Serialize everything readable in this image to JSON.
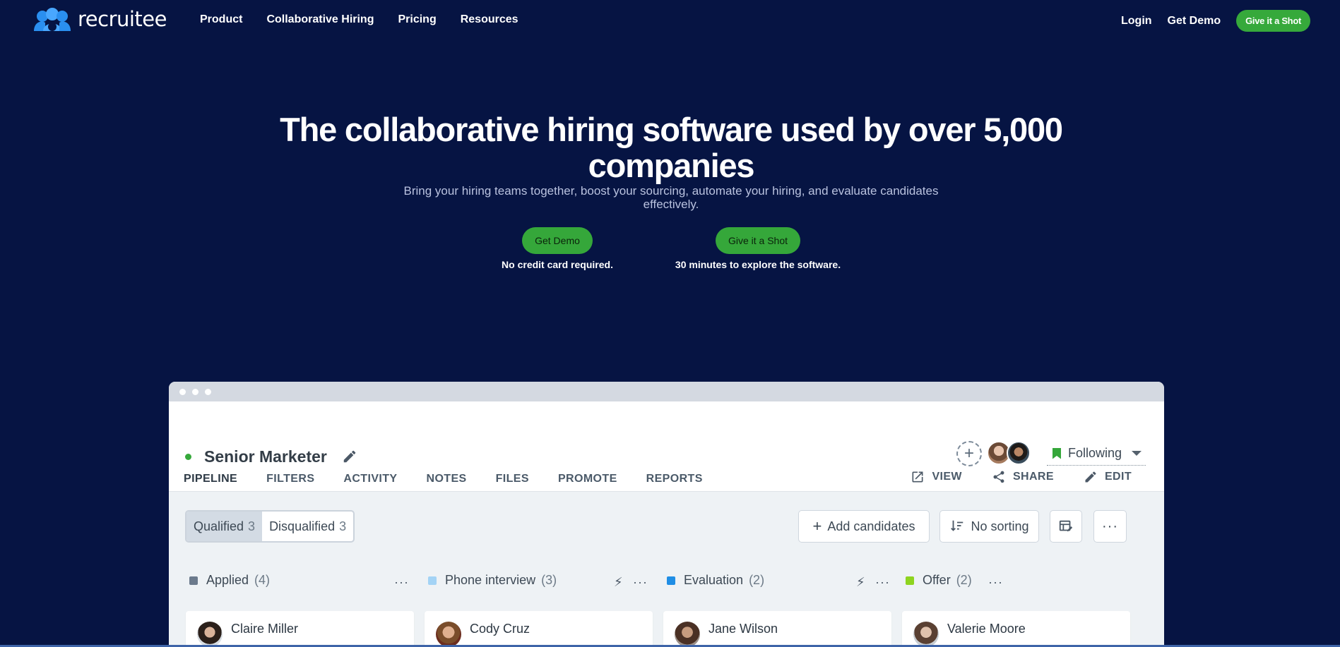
{
  "brand": {
    "name": "recruitee"
  },
  "nav": {
    "links": [
      "Product",
      "Collaborative Hiring",
      "Pricing",
      "Resources"
    ],
    "login": "Login",
    "get_demo": "Get Demo",
    "give_shot": "Give it a Shot"
  },
  "hero": {
    "title": "The collaborative hiring software used by over 5,000 companies",
    "subtitle": "Bring your hiring teams together, boost your sourcing, automate your hiring, and evaluate candidates effectively.",
    "cta_demo": {
      "label": "Get Demo",
      "note": "No credit card required."
    },
    "cta_shot": {
      "label": "Give it a Shot",
      "note": "30 minutes to explore the software."
    }
  },
  "app": {
    "job_title": "Senior Marketer",
    "following": "Following",
    "tabs": [
      "PIPELINE",
      "FILTERS",
      "ACTIVITY",
      "NOTES",
      "FILES",
      "PROMOTE",
      "REPORTS"
    ],
    "active_tab": "PIPELINE",
    "actions": {
      "view": "VIEW",
      "share": "SHARE",
      "edit": "EDIT"
    },
    "segments": {
      "qualified": {
        "label": "Qualified",
        "count": "3"
      },
      "disqualified": {
        "label": "Disqualified",
        "count": "3"
      }
    },
    "toolbar": {
      "add": "Add candidates",
      "sort": "No sorting"
    },
    "columns": [
      {
        "name": "Applied",
        "count": "(4)",
        "color": "#6b7a8c"
      },
      {
        "name": "Phone interview",
        "count": "(3)",
        "color": "#a3d3f5"
      },
      {
        "name": "Evaluation",
        "count": "(2)",
        "color": "#1f8ee5"
      },
      {
        "name": "Offer",
        "count": "(2)",
        "color": "#8ed41f"
      }
    ],
    "candidates": [
      "Claire Miller",
      "Cody Cruz",
      "Jane Wilson",
      "Valerie Moore"
    ]
  },
  "colors": {
    "background": "#061443",
    "accent_green": "#35a73a",
    "accent_blue": "#1f8ee5"
  }
}
